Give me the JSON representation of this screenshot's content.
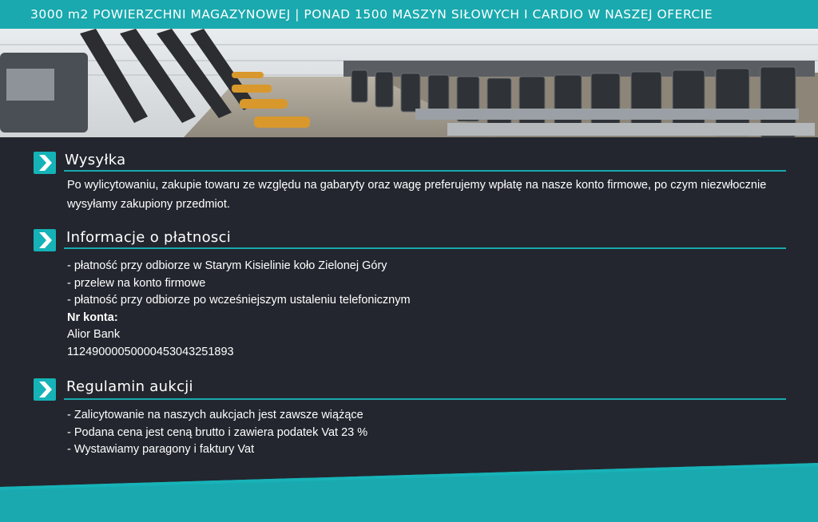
{
  "banner": {
    "text": "3000 m2 POWIERZCHNI MAGAZYNOWEJ  | PONAD 1500 MASZYN SIŁOWYCH I CARDIO W NASZEJ OFERCIE"
  },
  "colors": {
    "accent": "#19a9ae",
    "background": "#23262e",
    "text": "#ffffff"
  },
  "hero": {
    "icon": "warehouse-photo"
  },
  "sections": {
    "shipping": {
      "icon": "chevron-right-icon",
      "title": "Wysyłka",
      "text": "Po wylicytowaniu, zakupie towaru ze względu na gabaryty oraz wagę preferujemy wpłatę na nasze konto firmowe, po czym niezwłocznie wysyłamy zakupiony przedmiot."
    },
    "payment": {
      "icon": "chevron-right-icon",
      "title": "Informacje o płatnosci",
      "items": [
        "- płatność przy odbiorze w Starym Kisielinie koło Zielonej Góry",
        "- przelew na konto firmowe",
        "- płatność przy odbiorze po wcześniejszym ustaleniu telefonicznym"
      ],
      "account_label": "Nr konta:",
      "bank": "Alior Bank",
      "account_number": "11249000050000453043251893"
    },
    "rules": {
      "icon": "chevron-right-icon",
      "title": "Regulamin aukcji",
      "items": [
        "- Zalicytowanie na naszych aukcjach jest zawsze wiążące",
        "- Podana cena jest ceną brutto i zawiera podatek Vat 23 %",
        "- Wystawiamy paragony i faktury Vat"
      ]
    }
  }
}
